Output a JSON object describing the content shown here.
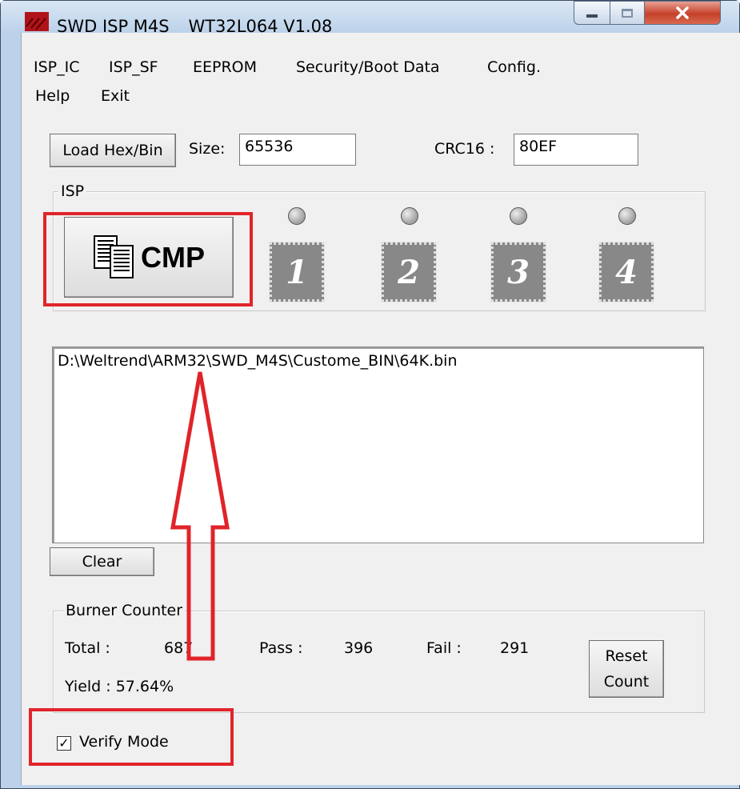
{
  "window": {
    "title": "SWD ISP M4S _ WT32L064  V1.08",
    "accent": "#e0242a"
  },
  "menu": [
    "ISP_IC",
    "ISP_SF",
    "EEPROM",
    "Security/Boot Data",
    "Config.",
    "Help",
    "Exit"
  ],
  "top": {
    "load_label": "Load Hex/Bin",
    "size_label": "Size:",
    "size_value": "65536",
    "crc_label": "CRC16 :",
    "crc_value": "80EF"
  },
  "isp": {
    "group_title": "ISP",
    "cmp_label": "CMP",
    "slots": [
      "1",
      "2",
      "3",
      "4"
    ]
  },
  "log": {
    "path": "D:\\Weltrend\\ARM32\\SWD_M4S\\Custome_BIN\\64K.bin"
  },
  "clear_label": "Clear",
  "counter": {
    "group_title": "Burner Counter",
    "total_label": "Total :",
    "total_value": "687",
    "pass_label": "Pass :",
    "pass_value": "396",
    "fail_label": "Fail :",
    "fail_value": "291",
    "yield_text": "Yield : 57.64%",
    "reset_line1": "Reset",
    "reset_line2": "Count"
  },
  "verify": {
    "label": "Verify Mode",
    "checked": true
  }
}
